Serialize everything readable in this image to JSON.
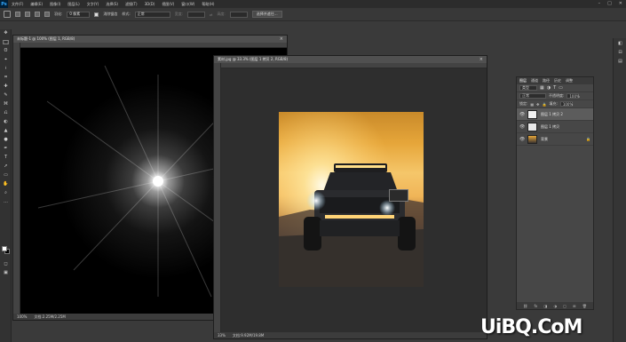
{
  "app": {
    "logo": "Ps"
  },
  "menu": {
    "items": [
      "文件(F)",
      "编辑(E)",
      "图像(I)",
      "图层(L)",
      "文字(Y)",
      "选择(S)",
      "滤镜(T)",
      "3D(D)",
      "视图(V)",
      "窗口(W)",
      "帮助(H)"
    ]
  },
  "window_controls": [
    "–",
    "□",
    "✕"
  ],
  "options": {
    "feather_label": "羽化:",
    "feather_value": "0 像素",
    "antialias_label": "消除锯齿",
    "style_label": "样式:",
    "style_value": "正常",
    "width_label": "宽度:",
    "height_label": "高度:",
    "select_mask_button": "选择并遮住..."
  },
  "tools": [
    "✥",
    "⬚",
    "ʘ",
    "⌖",
    "⟊",
    "⌗",
    "✚",
    "✎",
    "⌘",
    "⎌",
    "◐",
    "▲",
    "●",
    "✒",
    "T",
    "➚",
    "▭",
    "✋",
    "⌕",
    "…"
  ],
  "doc_flare": {
    "title": "未标题-1 @ 100% (图层 1, RGB/8)",
    "close": "×",
    "zoom": "100%",
    "info": "文档:2.25M/2.25M"
  },
  "doc_photo": {
    "title": "素材.jpg @ 33.3% (图层 1 拷贝 2, RGB/8)",
    "close": "×",
    "zoom": "33%",
    "info": "文档:9.92M/19.8M"
  },
  "layers_panel": {
    "tabs": [
      "图层",
      "通道",
      "路径",
      "历史",
      "调整"
    ],
    "filter_label": "类型",
    "blend_mode": "正常",
    "opacity_label": "不透明度:",
    "opacity_value": "100%",
    "lock_label": "锁定:",
    "fill_label": "填充:",
    "fill_value": "100%",
    "layers": [
      {
        "name": "图层 1 拷贝 2",
        "visible": "👁",
        "selected": true,
        "thumb": "#f2f2f2"
      },
      {
        "name": "图层 1 拷贝",
        "visible": "👁",
        "selected": false,
        "thumb": "#e8e8e8"
      },
      {
        "name": "背景",
        "visible": "👁",
        "selected": false,
        "thumb": "#c98a2a",
        "lock": "🔒"
      }
    ],
    "footer_icons": [
      "⛓",
      "fx",
      "◨",
      "◑",
      "▢",
      "⊞",
      "🗑"
    ]
  },
  "colors": {
    "foreground": "#ffffff",
    "background": "#000000",
    "accent": "#31a8ff"
  },
  "watermark": "UiBQ.CoM"
}
